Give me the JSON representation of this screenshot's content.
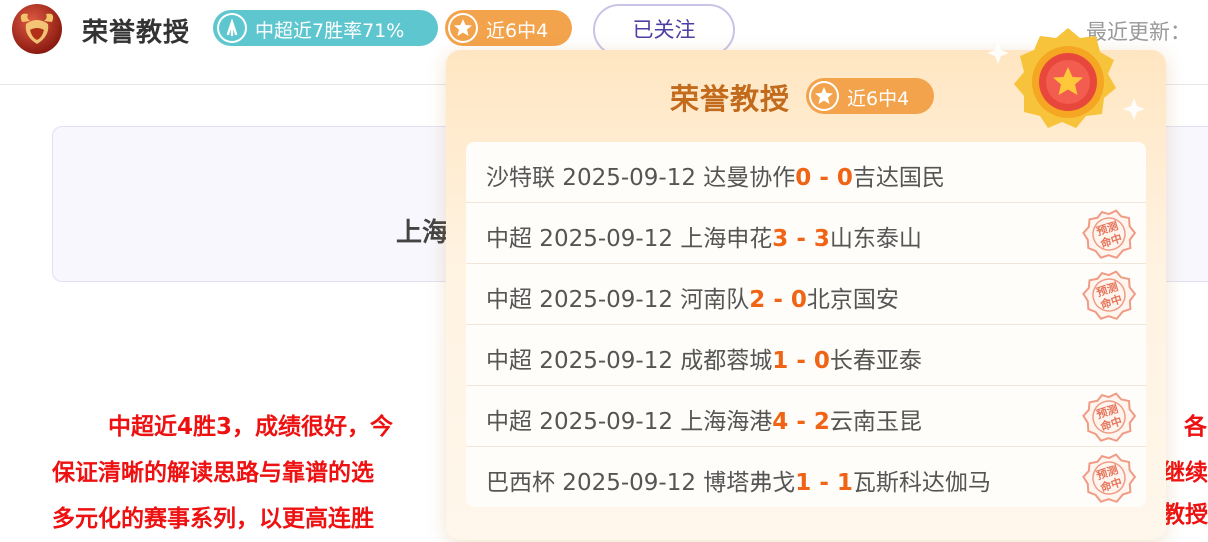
{
  "header": {
    "expert_name": "荣誉教授",
    "rate_badge": "中超近7胜率71%",
    "streak_badge": "近6中4",
    "follow_label": "已关注",
    "update_label": "最近更新："
  },
  "background": {
    "card_title": "上海",
    "paragraph_lines": [
      "中超近4胜3，成绩很好，今",
      "保证清晰的解读思路与靠谱的选",
      "多元化的赛事系列，以更高连胜"
    ],
    "right_fragments": [
      "各",
      "继续",
      "教授"
    ]
  },
  "popup": {
    "title": "荣誉教授",
    "badge": "近6中4",
    "stamp_text": "预测命中",
    "records": [
      {
        "prefix": "沙特联 2025-09-12 达曼协作",
        "home": "0",
        "dash": " - ",
        "away": "0",
        "away_team": "吉达国民",
        "hit": false
      },
      {
        "prefix": "中超 2025-09-12 上海申花",
        "home": "3",
        "dash": " - ",
        "away": "3",
        "away_team": "山东泰山",
        "hit": true
      },
      {
        "prefix": "中超 2025-09-12 河南队",
        "home": "2",
        "dash": " - ",
        "away": "0",
        "away_team": "北京国安",
        "hit": true
      },
      {
        "prefix": "中超 2025-09-12 成都蓉城",
        "home": "1",
        "dash": " - ",
        "away": "0",
        "away_team": "长春亚泰",
        "hit": false
      },
      {
        "prefix": "中超 2025-09-12 上海海港",
        "home": "4",
        "dash": " - ",
        "away": "2",
        "away_team": "云南玉昆",
        "hit": true
      },
      {
        "prefix": "巴西杯 2025-09-12 博塔弗戈",
        "home": "1",
        "dash": " - ",
        "away": "1",
        "away_team": "瓦斯科达伽马",
        "hit": true
      }
    ]
  },
  "colors": {
    "rate_badge": "#5ec6cf",
    "streak_badge": "#f3a34c",
    "score": "#f06416",
    "highlight_text": "#ee1111",
    "follow_text": "#4c3fa4"
  }
}
